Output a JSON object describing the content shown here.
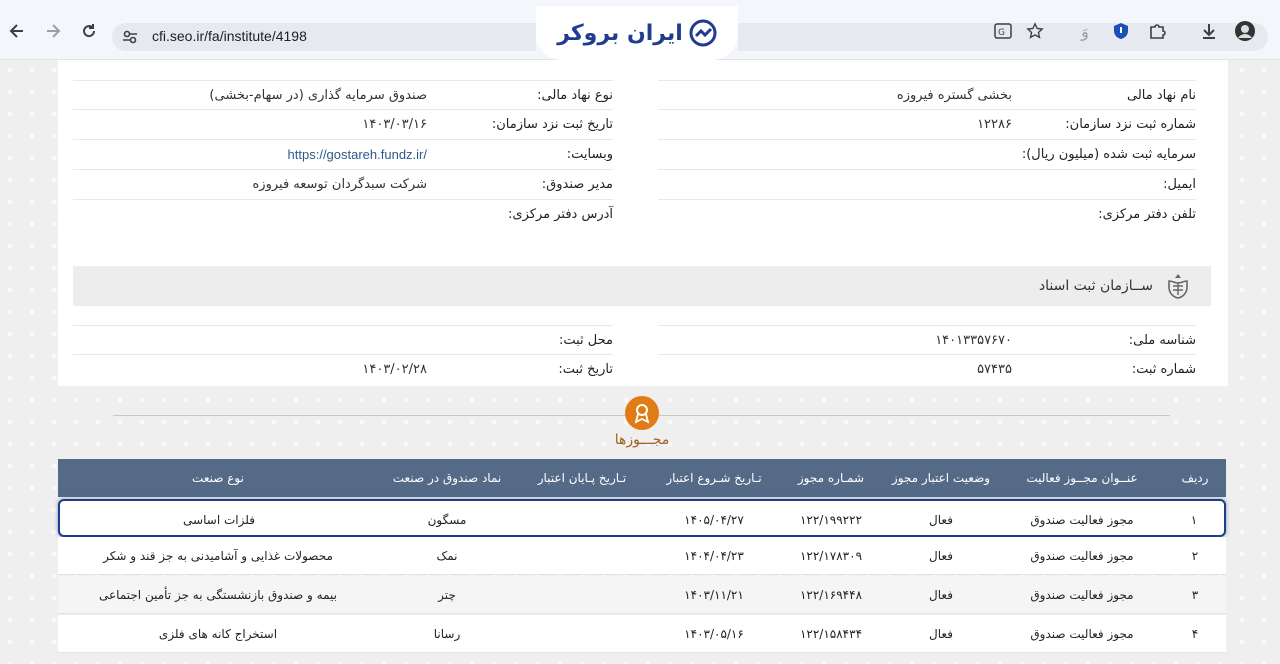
{
  "browser": {
    "url": "cfi.seo.ir/fa/institute/4198",
    "logo_text": "ایران بروکر"
  },
  "institute": {
    "right": [
      {
        "label": "نام نهاد مالی",
        "value": "بخشی گستره فیروزه"
      },
      {
        "label": "شماره ثبت نزد سازمان:",
        "value": "۱۲۲۸۶"
      },
      {
        "label": "سرمایه ثبت شده (میلیون ریال):",
        "value": ""
      },
      {
        "label": "ایمیل:",
        "value": ""
      },
      {
        "label": "تلفن دفتر مرکزی:",
        "value": ""
      }
    ],
    "left": [
      {
        "label": "نوع نهاد مالی:",
        "value": "صندوق سرمایه گذاری (در سهام-بخشی)"
      },
      {
        "label": "تاریخ ثبت نزد سازمان:",
        "value": "۱۴۰۳/۰۳/۱۶"
      },
      {
        "label": "وبسایت:",
        "value": "https://gostareh.fundz.ir/"
      },
      {
        "label": "مدیر صندوق:",
        "value": "شرکت سبدگردان توسعه فیروزه"
      },
      {
        "label": "آدرس دفتر مرکزی:",
        "value": ""
      }
    ]
  },
  "registry": {
    "title": "ســازمان ثبت اسناد",
    "right": [
      {
        "label": "شناسه ملی:",
        "value": "۱۴۰۱۳۳۵۷۶۷۰"
      },
      {
        "label": "شماره ثبت:",
        "value": "۵۷۴۳۵"
      }
    ],
    "left": [
      {
        "label": "محل ثبت:",
        "value": ""
      },
      {
        "label": "تاریخ ثبت:",
        "value": "۱۴۰۳/۰۲/۲۸"
      }
    ]
  },
  "licenses": {
    "title": "مجـــوزها",
    "headers": [
      "ردیف",
      "عنــوان مجــوز فعالیت",
      "وضعیت اعتبار مجوز",
      "شمـاره مجوز",
      "تـاریخ شـروع اعتبار",
      "تـاریخ پـایان اعتبار",
      "نماد صندوق در صنعت",
      "نوع صنعت"
    ],
    "rows": [
      [
        "۱",
        "مجوز فعالیت صندوق",
        "فعال",
        "۱۲۲/۱۹۹۲۲۲",
        "۱۴۰۵/۰۴/۲۷",
        "",
        "مسگون",
        "فلزات اساسی"
      ],
      [
        "۲",
        "مجوز فعالیت صندوق",
        "فعال",
        "۱۲۲/۱۷۸۳۰۹",
        "۱۴۰۴/۰۴/۲۳",
        "",
        "نمک",
        "محصولات غذایی و آشامیدنی به جز قند و شکر"
      ],
      [
        "۳",
        "مجوز فعالیت صندوق",
        "فعال",
        "۱۲۲/۱۶۹۴۴۸",
        "۱۴۰۳/۱۱/۲۱",
        "",
        "چتر",
        "بیمه و صندوق بازنشستگی به جز تأمین اجتماعی"
      ],
      [
        "۴",
        "مجوز فعالیت صندوق",
        "فعال",
        "۱۲۲/۱۵۸۴۳۴",
        "۱۴۰۳/۰۵/۱۶",
        "",
        "رسانا",
        "استخراج کانه های فلزی"
      ]
    ]
  },
  "colors": {
    "header_bg": "#556a86",
    "accent": "#e07b16",
    "selection": "#1d3d8a"
  }
}
